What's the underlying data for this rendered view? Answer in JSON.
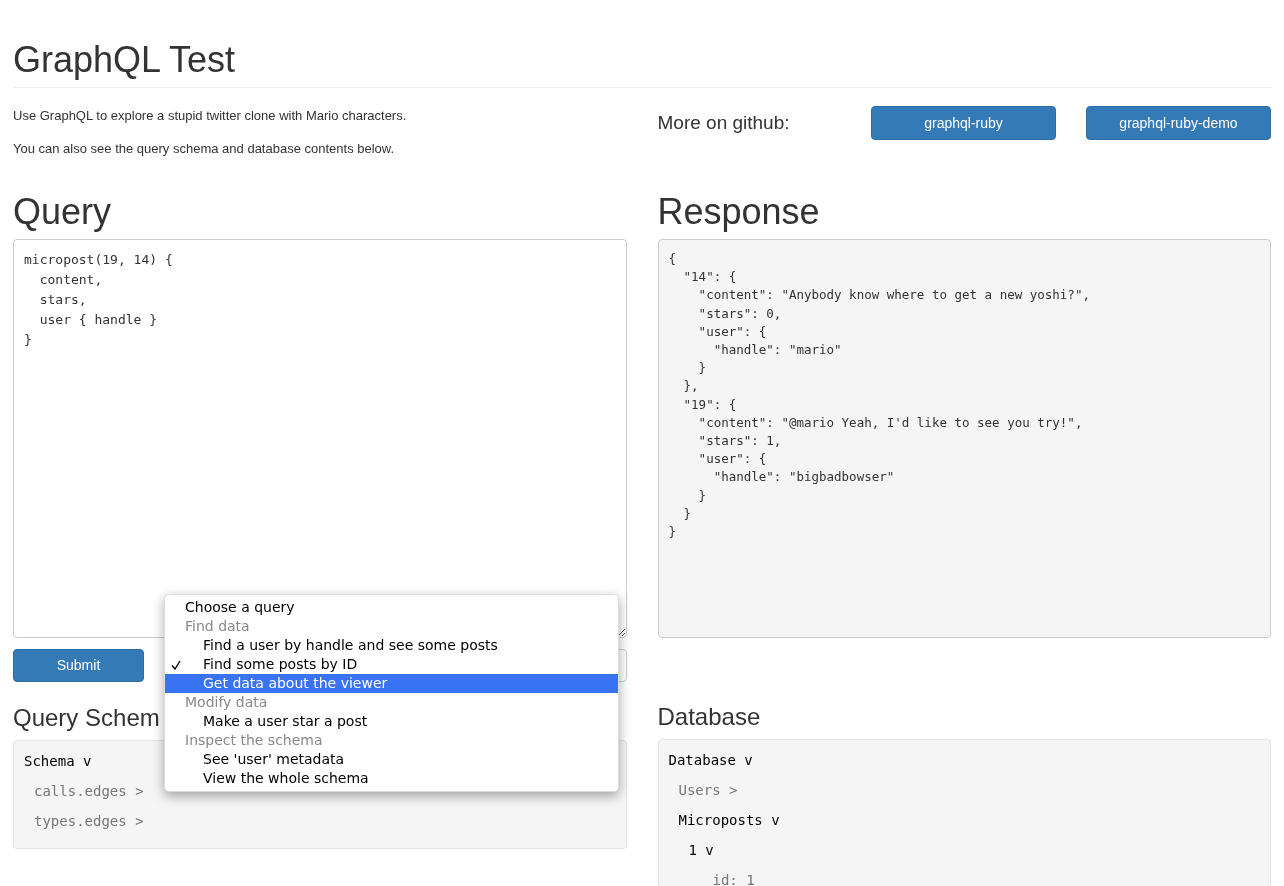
{
  "title": "GraphQL Test",
  "intro": [
    "Use GraphQL to explore a stupid twitter clone with Mario characters.",
    "You can also see the query schema and database contents below."
  ],
  "github": {
    "label": "More on github:",
    "links": [
      "graphql-ruby",
      "graphql-ruby-demo"
    ]
  },
  "query": {
    "heading": "Query",
    "value": "micropost(19, 14) {\n  content,\n  stars,\n  user { handle }\n}",
    "submit": "Submit"
  },
  "query_menu": [
    {
      "kind": "option",
      "label": "Choose a query",
      "selected": false,
      "highlighted": false
    },
    {
      "kind": "group",
      "label": "Find data"
    },
    {
      "kind": "option",
      "label": "Find a user by handle and see some posts",
      "selected": false,
      "highlighted": false
    },
    {
      "kind": "option",
      "label": "Find some posts by ID",
      "selected": true,
      "highlighted": false
    },
    {
      "kind": "option",
      "label": "Get data about the viewer",
      "selected": false,
      "highlighted": true
    },
    {
      "kind": "group",
      "label": "Modify data"
    },
    {
      "kind": "option",
      "label": "Make a user star a post",
      "selected": false,
      "highlighted": false
    },
    {
      "kind": "group",
      "label": "Inspect the schema"
    },
    {
      "kind": "option",
      "label": "See 'user' metadata",
      "selected": false,
      "highlighted": false
    },
    {
      "kind": "option",
      "label": "View the whole schema",
      "selected": false,
      "highlighted": false
    }
  ],
  "response": {
    "heading": "Response",
    "value": "{\n  \"14\": {\n    \"content\": \"Anybody know where to get a new yoshi?\",\n    \"stars\": 0,\n    \"user\": {\n      \"handle\": \"mario\"\n    }\n  },\n  \"19\": {\n    \"content\": \"@mario Yeah, I'd like to see you try!\",\n    \"stars\": 1,\n    \"user\": {\n      \"handle\": \"bigbadbowser\"\n    }\n  }\n}"
  },
  "schema": {
    "heading": "Query Schem",
    "tree": [
      {
        "label": "Schema",
        "toggle": "v",
        "expanded": true,
        "children": [
          {
            "label": "calls.edges",
            "toggle": ">",
            "expanded": false
          },
          {
            "label": "types.edges",
            "toggle": ">",
            "expanded": false
          }
        ]
      }
    ]
  },
  "database": {
    "heading": "Database",
    "tree": [
      {
        "label": "Database",
        "toggle": "v",
        "expanded": true,
        "children": [
          {
            "label": "Users",
            "toggle": ">",
            "expanded": false
          },
          {
            "label": "Microposts",
            "toggle": "v",
            "expanded": true,
            "children": [
              {
                "label": "1",
                "toggle": "v",
                "expanded": true,
                "children": [
                  {
                    "kind": "field",
                    "label": "id: 1"
                  }
                ]
              }
            ]
          }
        ]
      }
    ]
  }
}
